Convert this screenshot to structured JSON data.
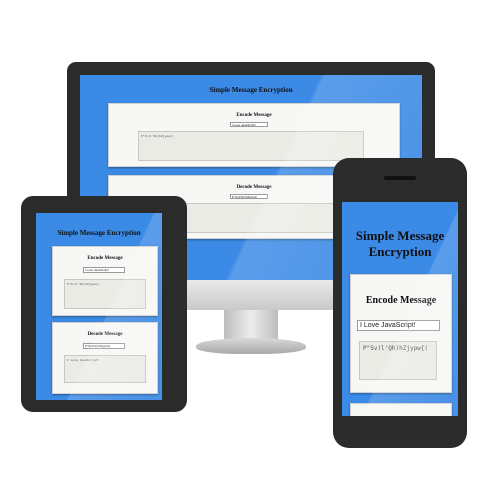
{
  "app": {
    "title": "Simple Message Encryption"
  },
  "encode": {
    "heading": "Encode Message",
    "input_value": "I Love JavaScript!",
    "output_value": "P\"Sv)l'Qh)hZjypw{("
  },
  "decode": {
    "heading": "Decode Message",
    "input_value": "P\"Sv)l'Qh)hZjypw{(",
    "output_value": "I Love JavaScript!"
  },
  "colors": {
    "screen_background": "#3b8ae6",
    "device_bezel": "#2b2b2b",
    "card_background": "#f7f7f5"
  }
}
